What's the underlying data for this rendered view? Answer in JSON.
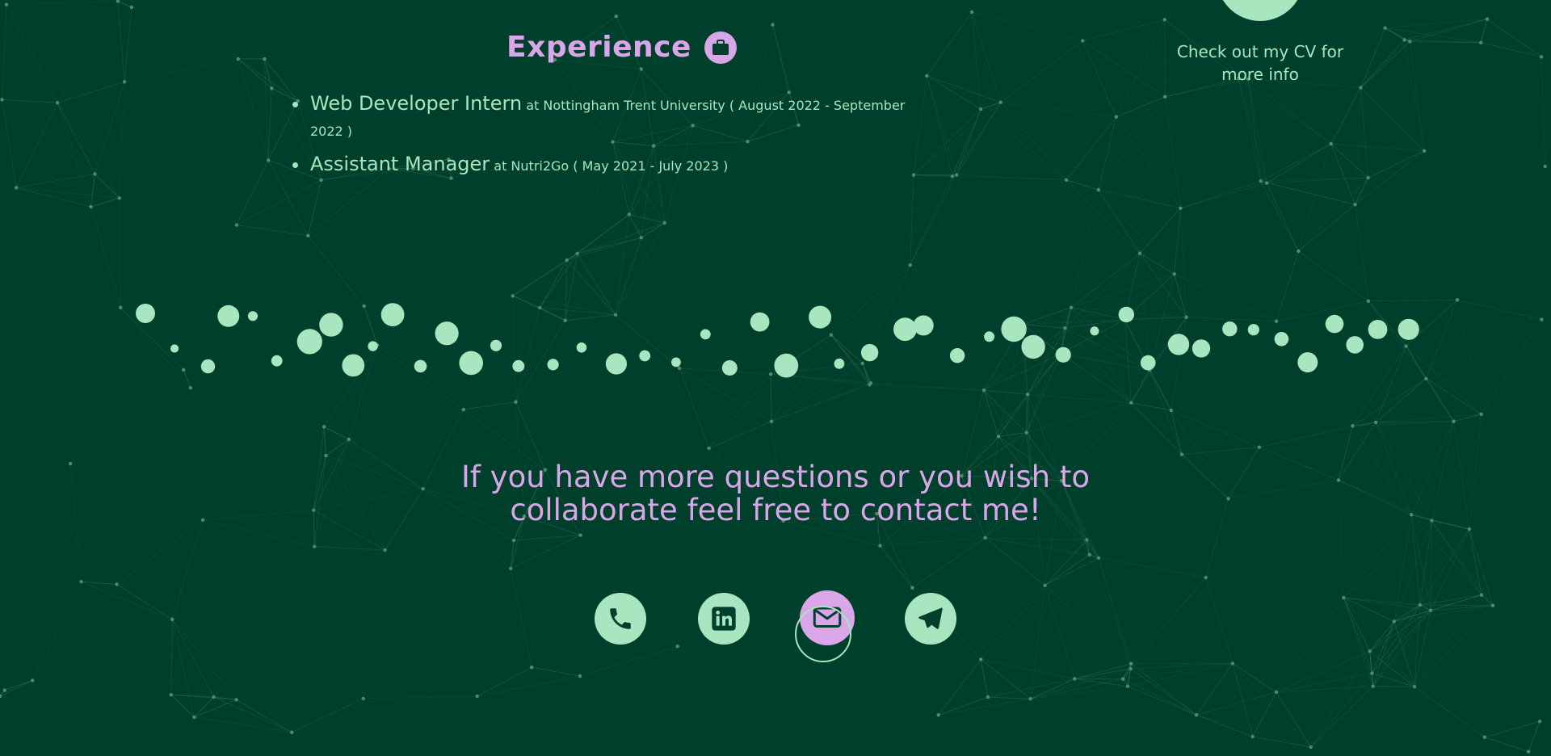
{
  "experience": {
    "title": "Experience",
    "title_icon": "briefcase-icon",
    "items": [
      {
        "role": "Web Developer Intern",
        "detail": "at Nottingham Trent University ( August 2022 - September 2022 )"
      },
      {
        "role": "Assistant Manager",
        "detail": "at Nutri2Go ( May 2021 - July 2023 )"
      }
    ]
  },
  "cv": {
    "text": "Check out my CV for more info"
  },
  "contact": {
    "message": "If you have more questions or you wish to collaborate feel free to contact me!",
    "buttons": [
      {
        "name": "phone",
        "icon": "phone-icon"
      },
      {
        "name": "linkedin",
        "icon": "linkedin-icon"
      },
      {
        "name": "email",
        "icon": "mail-icon"
      },
      {
        "name": "telegram",
        "icon": "telegram-icon"
      }
    ]
  },
  "colors": {
    "background": "#013f2d",
    "accent_green": "#a8e6bf",
    "accent_purple": "#d9a6e8",
    "network_lines": "#3f7a5c"
  }
}
